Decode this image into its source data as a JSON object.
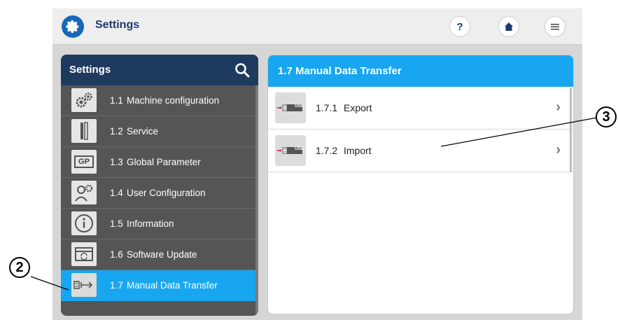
{
  "app": {
    "title": "Settings"
  },
  "toolbar": {
    "help_label": "?"
  },
  "sidebar": {
    "title": "Settings",
    "items": [
      {
        "num": "1.1",
        "label": "Machine configuration",
        "icon": "gears-icon"
      },
      {
        "num": "1.2",
        "label": "Service",
        "icon": "tools-icon"
      },
      {
        "num": "1.3",
        "label": "Global Parameter",
        "icon": "gp-icon",
        "icon_text": "GP"
      },
      {
        "num": "1.4",
        "label": "User Configuration",
        "icon": "user-gear-icon"
      },
      {
        "num": "1.5",
        "label": "Information",
        "icon": "info-icon"
      },
      {
        "num": "1.6",
        "label": "Software Update",
        "icon": "software-update-icon"
      },
      {
        "num": "1.7",
        "label": "Manual Data Transfer",
        "icon": "usb-transfer-icon",
        "active": true
      }
    ]
  },
  "main": {
    "title": "1.7 Manual Data Transfer",
    "items": [
      {
        "num": "1.7.1",
        "label": "Export",
        "icon_text": "USB"
      },
      {
        "num": "1.7.2",
        "label": "Import",
        "icon_text": "USB"
      }
    ]
  },
  "callouts": {
    "left": "2",
    "right": "3"
  },
  "colors": {
    "accent": "#18a6f0",
    "header_dark": "#1f3a5f",
    "panel_gray": "#555555",
    "logo": "#1868b8"
  }
}
